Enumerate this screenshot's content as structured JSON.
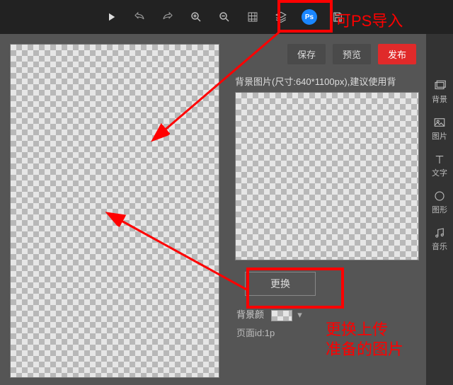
{
  "toolbar": {
    "ps_label": "Ps"
  },
  "actions": {
    "save": "保存",
    "preview": "预览",
    "publish": "发布"
  },
  "panel": {
    "description": "背景图片(尺寸:640*1100px),建议使用背",
    "replace_label": "更换",
    "bgcolor_label": "背景颜",
    "pageid_label": "页面id:1p"
  },
  "tabs": {
    "bg": "背景",
    "image": "图片",
    "text": "文字",
    "shape": "图形",
    "music": "音乐"
  },
  "annotations": {
    "ps_import": "可PS导入",
    "replace_upload_l1": "更换上传",
    "replace_upload_l2": "准备的图片"
  }
}
